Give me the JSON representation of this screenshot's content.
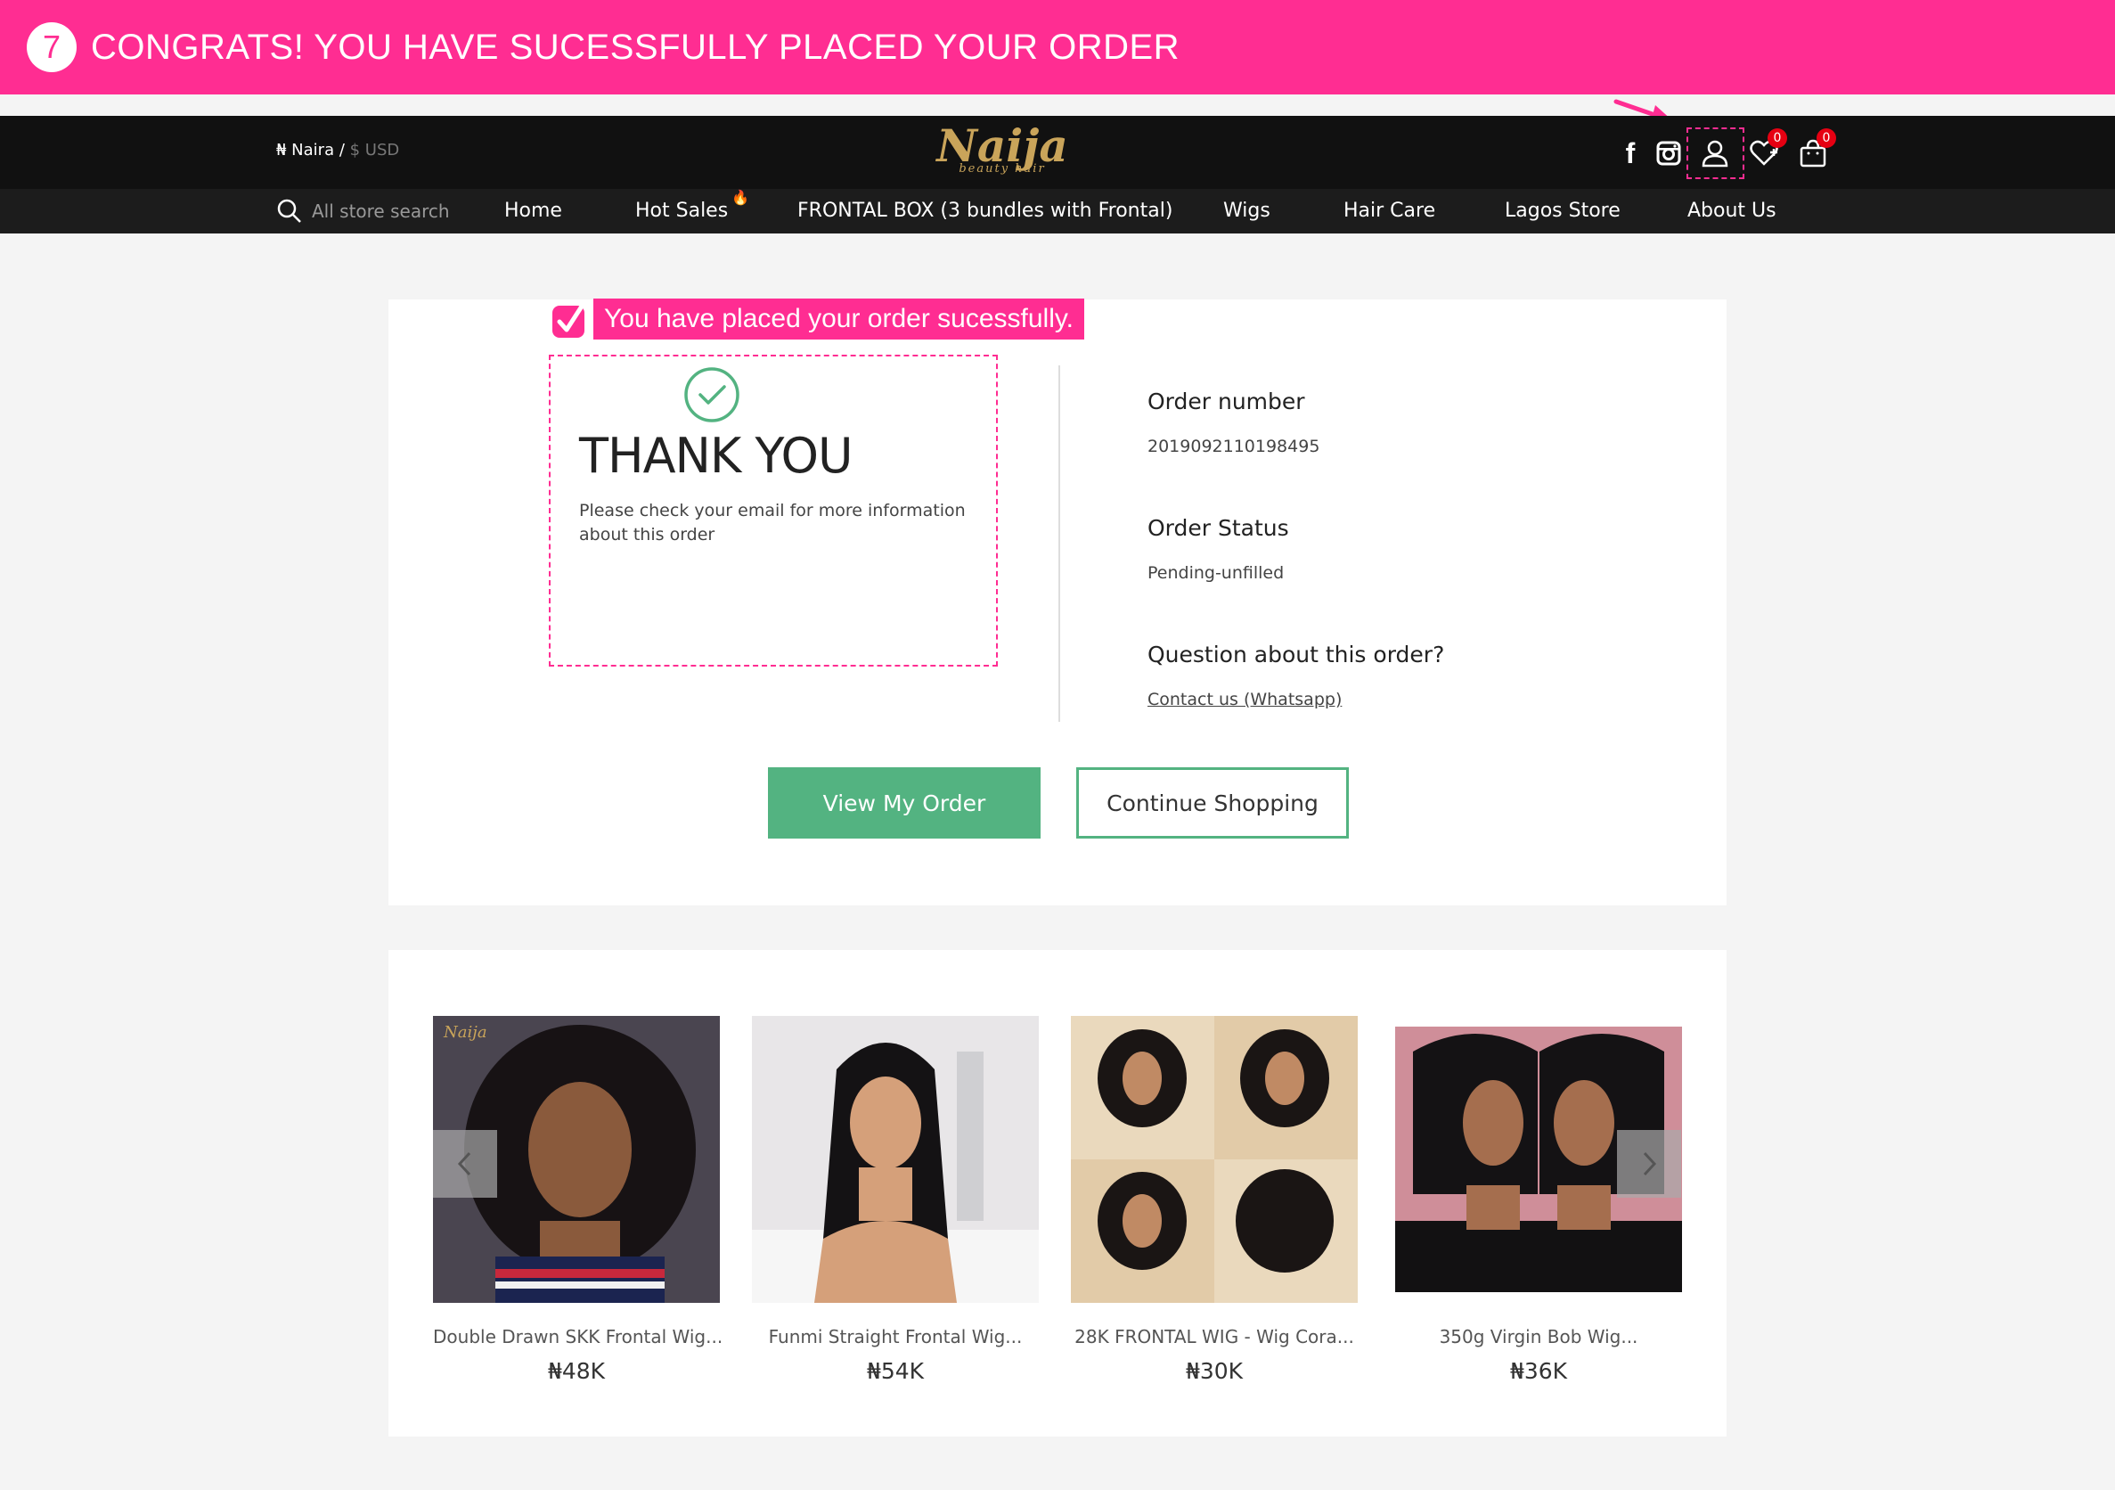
{
  "banner": {
    "step_number": "7",
    "text": "CONGRATS! YOU HAVE SUCESSFULLY PLACED YOUR ORDER",
    "color": "#ff2d92"
  },
  "header": {
    "currency_primary": "₦ Naira /",
    "currency_alt": " $ USD",
    "logo_text": "Naija",
    "logo_sub": "beauty hair",
    "icons": [
      "facebook-icon",
      "instagram-icon",
      "user-icon",
      "wishlist-icon",
      "cart-icon"
    ],
    "wishlist_count": "0",
    "cart_count": "0"
  },
  "nav": {
    "search_placeholder": "All store search",
    "items": [
      "Home",
      "Hot Sales",
      "FRONTAL BOX (3 bundles with Frontal)",
      "Wigs",
      "Hair Care",
      "Lagos Store",
      "About Us"
    ],
    "hot_tag": "🔥"
  },
  "order": {
    "success_note": "You have placed your order sucessfully.",
    "thanks_title": "THANK YOU",
    "thanks_message": "Please check your email for more information about this order",
    "order_number_label": "Order number",
    "order_number": "2019092110198495",
    "order_status_label": "Order Status",
    "order_status": "Pending-unfilled",
    "question_label": "Question about this order?",
    "contact_link": "Contact us (Whatsapp)",
    "view_order_button": "View My Order",
    "continue_button": "Continue Shopping",
    "accent_color": "#53b381"
  },
  "products": [
    {
      "name": "Double Drawn SKK Frontal Wig...",
      "price": "₦48K"
    },
    {
      "name": "Funmi Straight Frontal Wig...",
      "price": "₦54K"
    },
    {
      "name": "28K FRONTAL WIG - Wig Cora...",
      "price": "₦30K"
    },
    {
      "name": "350g Virgin Bob Wig...",
      "price": "₦36K"
    }
  ]
}
